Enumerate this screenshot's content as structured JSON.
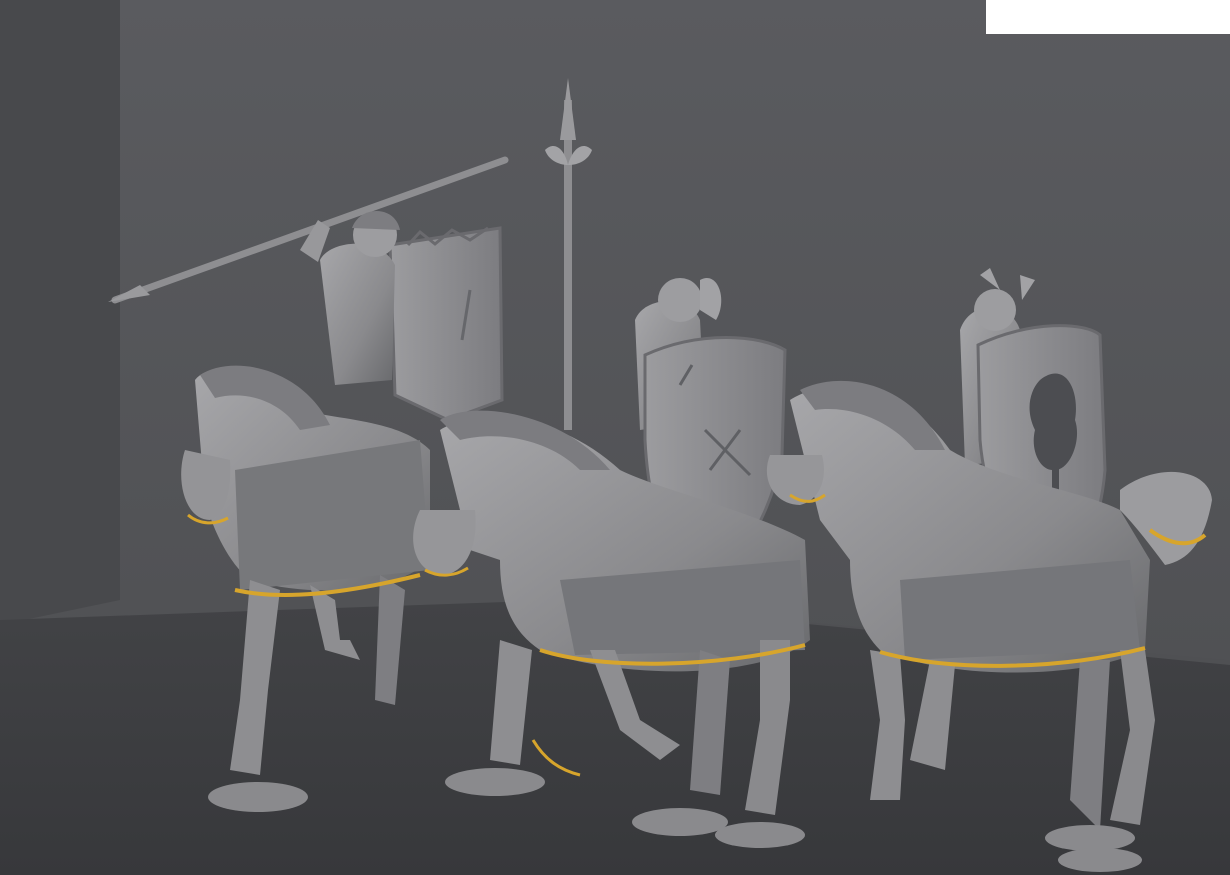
{
  "scene": {
    "subject": "three-mounted-cavalry-miniatures",
    "colors": {
      "background_wall": "#55565a",
      "floor": "#3d3e41",
      "model_gray": "#8d8d90",
      "model_highlight": "#b4b4b7",
      "model_shadow": "#5e5f63",
      "seam_gold": "#d7a52c",
      "corner_panel": "#ffffff"
    },
    "figures": [
      {
        "name": "rider-left",
        "weapon": "spear",
        "shield": "tall-banner-shield"
      },
      {
        "name": "rider-center",
        "weapon": "lance",
        "shield": "kite-shield"
      },
      {
        "name": "rider-right",
        "weapon": "none-visible",
        "shield": "tree-emblem-shield"
      }
    ]
  }
}
